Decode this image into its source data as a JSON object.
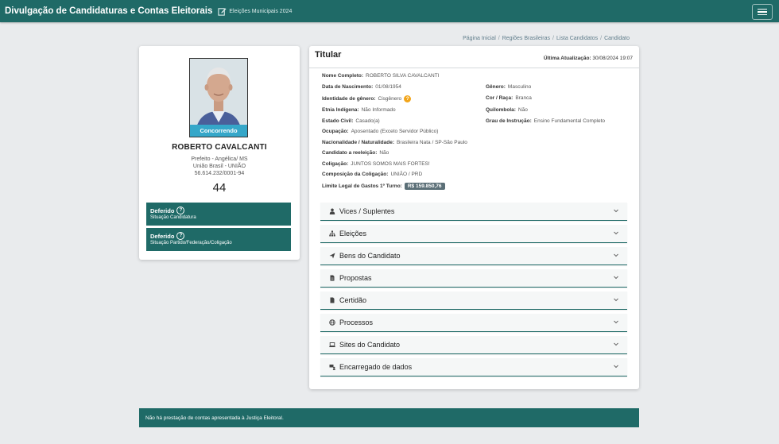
{
  "header": {
    "title": "Divulgação de Candidaturas e Contas Eleitorais",
    "election": "Eleições Municipais 2024"
  },
  "breadcrumb": [
    "Página Inicial",
    "Regiões Brasileiras",
    "Lista Candidatos",
    "Candidato"
  ],
  "candidate": {
    "status_ribbon": "Concorrendo",
    "name": "ROBERTO CAVALCANTI",
    "office": "Prefeito - Angélica/ MS",
    "party": "União Brasil - UNIÃO",
    "cnpj": "56.614.232/0001-94",
    "number": "44",
    "situations": [
      {
        "title": "Deferido",
        "subtitle": "Situação Candidatura"
      },
      {
        "title": "Deferido",
        "subtitle": "Situação Partido/Federação/Coligação"
      }
    ]
  },
  "details": {
    "title": "Titular",
    "last_update_label": "Última Atualização:",
    "last_update_value": "30/08/2024 19:07",
    "left_fields": [
      {
        "label": "Nome Completo:",
        "value": "ROBERTO SILVA CAVALCANTI"
      },
      {
        "label": "Data de Nascimento:",
        "value": "01/08/1954"
      },
      {
        "label": "Identidade de gênero:",
        "value": "Cisgênero"
      },
      {
        "label": "Etnia Indígena:",
        "value": "Não Informado"
      },
      {
        "label": "Estado Civil:",
        "value": "Casado(a)"
      },
      {
        "label": "Ocupação:",
        "value": "Aposentado (Exceto Servidor Público)"
      },
      {
        "label": "Nacionalidade / Naturalidade:",
        "value": "Brasileira Nata / SP-São Paulo"
      },
      {
        "label": "Candidato a reeleição:",
        "value": "Não"
      },
      {
        "label": "Coligação:",
        "value": "JUNTOS SOMOS MAIS FORTES!"
      },
      {
        "label": "Composição da Coligação:",
        "value": "UNIÃO / PRD"
      },
      {
        "label": "Limite Legal de Gastos 1º Turno:",
        "value": "R$ 159.850,76"
      }
    ],
    "right_fields": [
      {
        "label": "Gênero:",
        "value": "Masculino"
      },
      {
        "label": "Cor / Raça:",
        "value": "Branca"
      },
      {
        "label": "Quilombola:",
        "value": "Não"
      },
      {
        "label": "Grau de Instrução:",
        "value": "Ensino Fundamental Completo"
      }
    ]
  },
  "sections": [
    {
      "label": "Vices / Suplentes",
      "icon": "user-icon"
    },
    {
      "label": "Eleições",
      "icon": "sitemap-icon"
    },
    {
      "label": "Bens do Candidato",
      "icon": "send-icon"
    },
    {
      "label": "Propostas",
      "icon": "file-icon"
    },
    {
      "label": "Certidão",
      "icon": "document-icon"
    },
    {
      "label": "Processos",
      "icon": "globe-icon"
    },
    {
      "label": "Sites do Candidato",
      "icon": "laptop-icon"
    },
    {
      "label": "Encarregado de dados",
      "icon": "data-officer-icon"
    }
  ],
  "footer": {
    "message": "Não há prestação de contas apresentada à Justiça Eleitoral."
  },
  "colors": {
    "primary": "#1f6a67",
    "ribbon": "#35a7c9",
    "badge": "#5b6f77",
    "warning": "#f2a51a"
  }
}
